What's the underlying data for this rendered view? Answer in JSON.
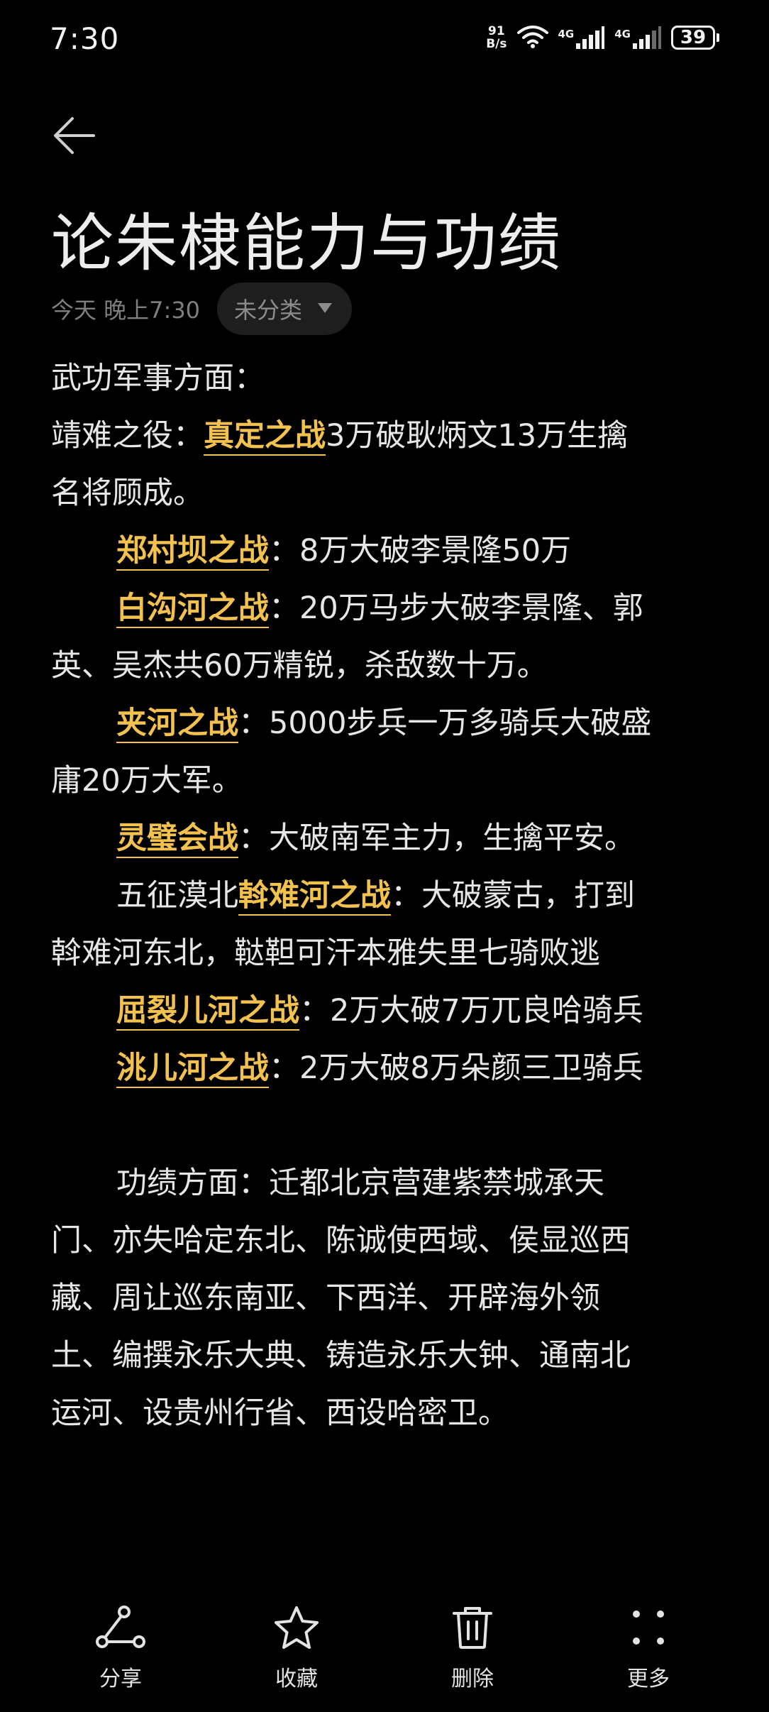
{
  "status_bar": {
    "time": "7:30",
    "net_speed_value": "91",
    "net_speed_unit": "B/s",
    "signal1_label": "4G",
    "signal2_label": "4G",
    "battery": "39",
    "icons": [
      "wifi-icon",
      "signal-icon",
      "signal-icon",
      "battery-icon"
    ]
  },
  "header": {
    "back_icon": "arrow-left-icon",
    "title": "论朱棣能力与功绩",
    "date": "今天 晚上7:30",
    "category": "未分类",
    "category_icon": "triangle-down-icon"
  },
  "body": {
    "l1": "武功军事方面：",
    "l2_pre": "靖难之役：",
    "l2_hl": "真定之战",
    "l2_post": "3万破耿炳文13万生擒",
    "l3": "名将顾成。",
    "l4_hl": "郑村坝之战",
    "l4_post": "：8万大破李景隆50万",
    "l5_hl": "白沟河之战",
    "l5_post": "：20万马步大破李景隆、郭",
    "l6": "英、吴杰共60万精锐，杀敌数十万。",
    "l7_hl": "夹河之战",
    "l7_post": "：5000步兵一万多骑兵大破盛",
    "l8": "庸20万大军。",
    "l9_hl": "灵璧会战",
    "l9_post": "：大破南军主力，生擒平安。",
    "l10_pre": "五征漠北",
    "l10_hl": "斡难河之战",
    "l10_post": "：大破蒙古，打到",
    "l11": "斡难河东北，鞑靼可汗本雅失里七骑败逃",
    "l12_hl": "屈裂儿河之战",
    "l12_post": "：2万大破7万兀良哈骑兵",
    "l13_hl": "洮儿河之战",
    "l13_post": "：2万大破8万朵颜三卫骑兵",
    "l15": "功绩方面：迁都北京营建紫禁城承天",
    "l16": "门、亦失哈定东北、陈诚使西域、侯显巡西",
    "l17": "藏、周让巡东南亚、下西洋、开辟海外领",
    "l18": "土、编撰永乐大典、铸造永乐大钟、通南北",
    "l19": "运河、设贵州行省、西设哈密卫。"
  },
  "bottom_bar": {
    "items": [
      {
        "label": "分享",
        "icon": "share-icon"
      },
      {
        "label": "收藏",
        "icon": "star-icon"
      },
      {
        "label": "删除",
        "icon": "trash-icon"
      },
      {
        "label": "更多",
        "icon": "more-icon"
      }
    ]
  },
  "colors": {
    "background": "#000000",
    "text": "#e6e6e6",
    "highlight": "#f3c24e",
    "muted": "#7f7f7f",
    "chip_bg": "#1e1e1e"
  }
}
